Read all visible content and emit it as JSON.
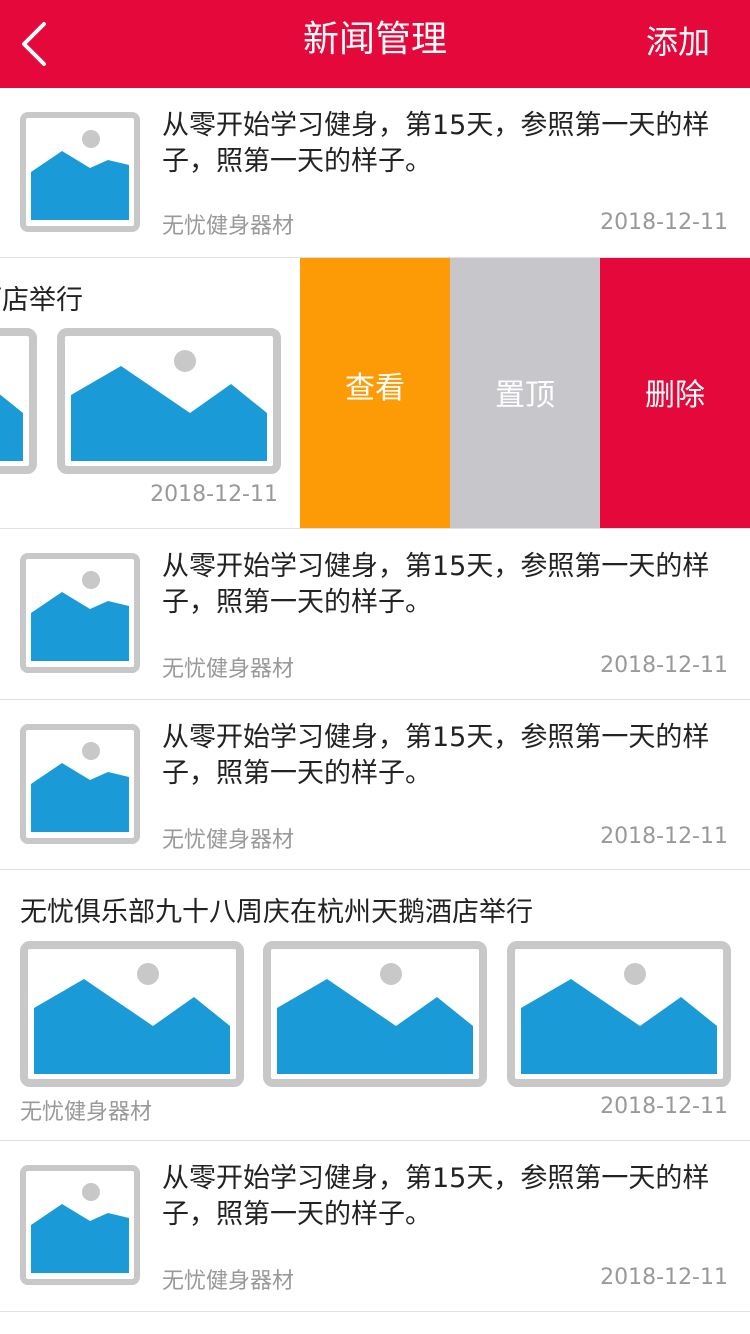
{
  "header": {
    "title": "新闻管理",
    "add_label": "添加",
    "background": "#e5083a"
  },
  "news": {
    "title_short": "从零开始学习健身，第15天，参照第一天的样子，照第一天的样子。",
    "title_long": "无忧俱乐部九十八周庆在杭州天鹅酒店举行",
    "title_long_partial": "酒店举行",
    "source": "无忧健身器材",
    "date": "2018-12-11"
  },
  "swipe_actions": {
    "view_label": "查看",
    "pin_label": "置顶",
    "delete_label": "删除",
    "view_color": "#fd9b07",
    "pin_color": "#c6c6cb",
    "delete_color": "#e5083a"
  },
  "icons": {
    "back": "back-arrow-icon",
    "image_placeholder": "image-placeholder-icon"
  }
}
